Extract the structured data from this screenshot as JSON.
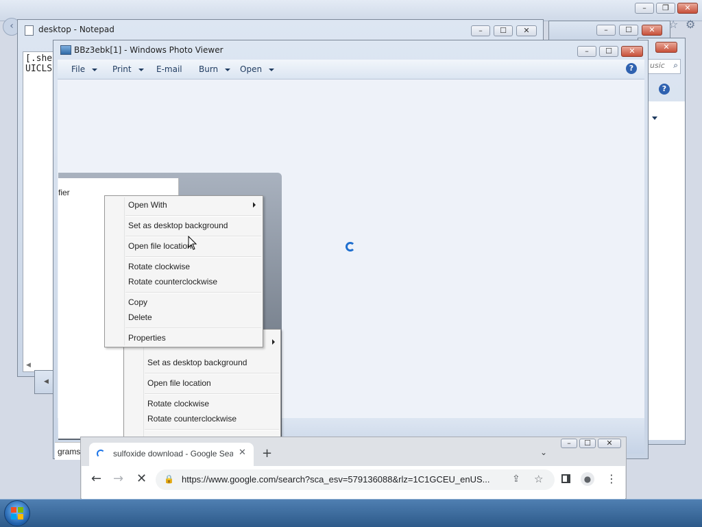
{
  "notepad": {
    "title": "desktop - Notepad",
    "lines": [
      "[.she",
      "UICLS"
    ]
  },
  "photo_viewer": {
    "title": "BBz3ebk[1] - Windows Photo Viewer",
    "menu": [
      "File",
      "Print",
      "E-mail",
      "Burn",
      "Open"
    ],
    "search_hint": "usic",
    "inner_label": "fier",
    "taskbar_label": "grams"
  },
  "context_menu_front": {
    "items": [
      "Open With",
      "Set as desktop background",
      "Open file location",
      "Rotate clockwise",
      "Rotate counterclockwise",
      "Copy",
      "Delete",
      "Properties"
    ]
  },
  "context_menu_back": {
    "items": [
      "Set as desktop background",
      "Open file location",
      "Rotate clockwise",
      "Rotate counterclockwise"
    ]
  },
  "chrome": {
    "tab_title": "sulfoxide download - Google Sea",
    "url": "https://www.google.com/search?sca_esv=579136088&rlz=1C1GCEU_enUS..."
  },
  "colors": {
    "accent": "#1f6fcf",
    "taskbar": "#3b6a9c",
    "close": "#c7503a"
  }
}
